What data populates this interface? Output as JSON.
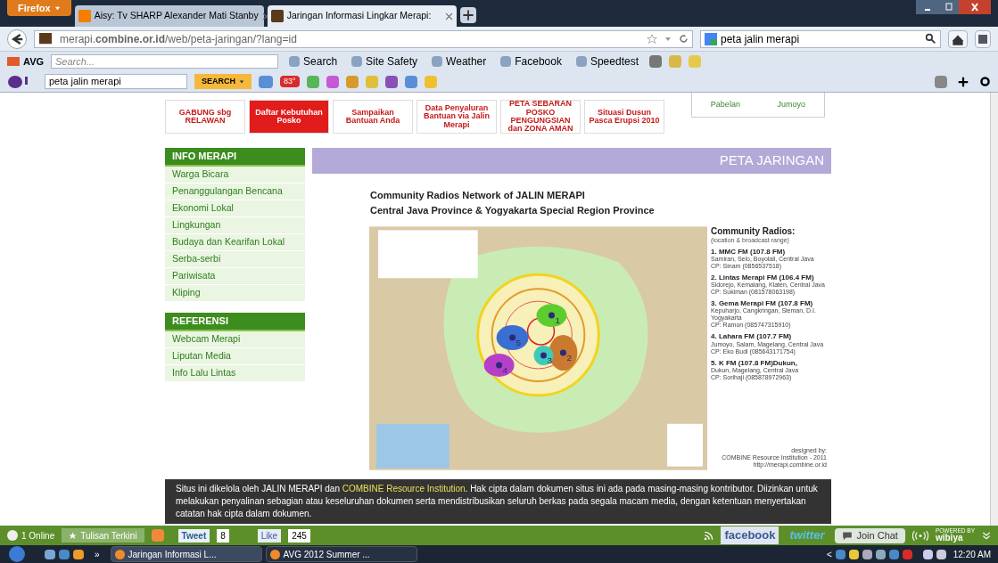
{
  "browser": {
    "menu_button": "Firefox",
    "tabs": [
      {
        "label": "Aisy: Tv SHARP Alexander Mati Stanby",
        "selected": false
      },
      {
        "label": "Jaringan Informasi Lingkar Merapi:",
        "selected": true
      }
    ],
    "url": "merapi.**combine.or.id**/web/peta-jaringan/?lang=id",
    "search_value": "peta jalin merapi"
  },
  "avg_toolbar": {
    "brand": "AVG",
    "placeholder": "Search...",
    "buttons": [
      "Search",
      "Site Safety",
      "Weather",
      "Facebook",
      "Speedtest"
    ]
  },
  "yahoo_toolbar": {
    "search_value": "peta jalin merapi",
    "search_button": "SEARCH",
    "weather_badge": "83°"
  },
  "banners": [
    {
      "text": "GABUNG sbg RELAWAN",
      "kind": "plain"
    },
    {
      "text": "Daftar Kebutuhan Posko",
      "kind": "filled"
    },
    {
      "text": "Sampaikan Bantuan Anda",
      "kind": "plain"
    },
    {
      "text": "Data Penyaluran Bantuan via Jalin Merapi",
      "kind": "plain"
    },
    {
      "text": "PETA SEBARAN POSKO PENGUNGSIAN dan ZONA AMAN",
      "kind": "plain"
    },
    {
      "text": "Situasi Dusun Pasca Erupsi 2010",
      "kind": "plain"
    }
  ],
  "village_box": [
    "Pabelan",
    "Jumoyo"
  ],
  "sidebar": [
    {
      "heading": "INFO MERAPI",
      "items": [
        "Warga Bicara",
        "Penanggulangan Bencana",
        "Ekonomi Lokal",
        "Lingkungan",
        "Budaya dan Kearifan Lokal",
        "Serba-serbi",
        "Pariwisata",
        "Kliping"
      ]
    },
    {
      "heading": "REFERENSI",
      "items": [
        "Webcam Merapi",
        "Liputan Media",
        "Info Lalu Lintas"
      ]
    }
  ],
  "page_header": "PETA JARINGAN",
  "map": {
    "title_lines": [
      "Community Radios Network of JALIN MERAPI",
      "Central Java Province & Yogyakarta Special Region Province"
    ],
    "markers": [
      {
        "label": "1",
        "color": "#5ccc2e"
      },
      {
        "label": "2",
        "color": "#c97a2e"
      },
      {
        "label": "3",
        "color": "#3fc9b8"
      },
      {
        "label": "4",
        "color": "#b63fc9"
      },
      {
        "label": "5",
        "color": "#3a6fd1"
      }
    ],
    "legend_title": "Community Radios:",
    "legend_subtitle": "(location & broadcast range)",
    "radios": [
      {
        "name": "1. MMC FM (107.8 FM)",
        "address": "Samiran, Selo, Boyolali, Central Java",
        "contact": "CP: Sinam (0856537518)"
      },
      {
        "name": "2. Lintas Merapi FM (106.4 FM)",
        "address": "Sidorejo, Kemalang, Klaten, Central Java",
        "contact": "CP: Sukiman (081578063198)"
      },
      {
        "name": "3. Gema Merapi FM (107.8 FM)",
        "address": "Kepuharjo, Cangkringan, Sleman, D.I. Yogyakarta",
        "contact": "CP: Ramon (085747315910)"
      },
      {
        "name": "4. Lahara FM (107.7 FM)",
        "address": "Jumoyo, Salam, Magelang, Central Java",
        "contact": "CP: Eko Budi (085643171754)"
      },
      {
        "name": "5. K FM (107.8 FM)Dukun,",
        "address": "Dukun, Magelang, Central Java",
        "contact": "CP: Sorihaji (085878972963)"
      }
    ],
    "credit": [
      "designed by:",
      "COMBINE Resource Institution - 2011",
      "http://merapi.combine.or.id"
    ]
  },
  "footer": {
    "before": "Situs ini dikelola oleh JALIN MERAPI dan ",
    "link": "COMBINE Resource Institution",
    "after": ". Hak cipta dalam dokumen situs ini ada pada masing-masing kontributor. Diizinkan untuk melakukan penyalinan sebagian atau keseluruhan dokumen serta mendistribusikan seluruh berkas pada segala macam media, dengan ketentuan menyertakan catatan hak cipta dalam dokumen."
  },
  "wibiya_bar": {
    "online": "1 Online",
    "recent": "Tulisan Terkini",
    "tweet": "Tweet",
    "tweet_count": "8",
    "like": "Like",
    "like_count": "245",
    "facebook": "facebook",
    "twitter": "twitter",
    "chat": "Join Chat",
    "powered": "POWERED BY",
    "brand": "wibiya"
  },
  "taskbar": {
    "overflow": "»",
    "tasks": [
      {
        "label": "Jaringan Informasi L...",
        "selected": true
      },
      {
        "label": "AVG 2012 Summer ...",
        "selected": false
      }
    ],
    "tray_arrow": "<",
    "time": "12:20 AM"
  }
}
